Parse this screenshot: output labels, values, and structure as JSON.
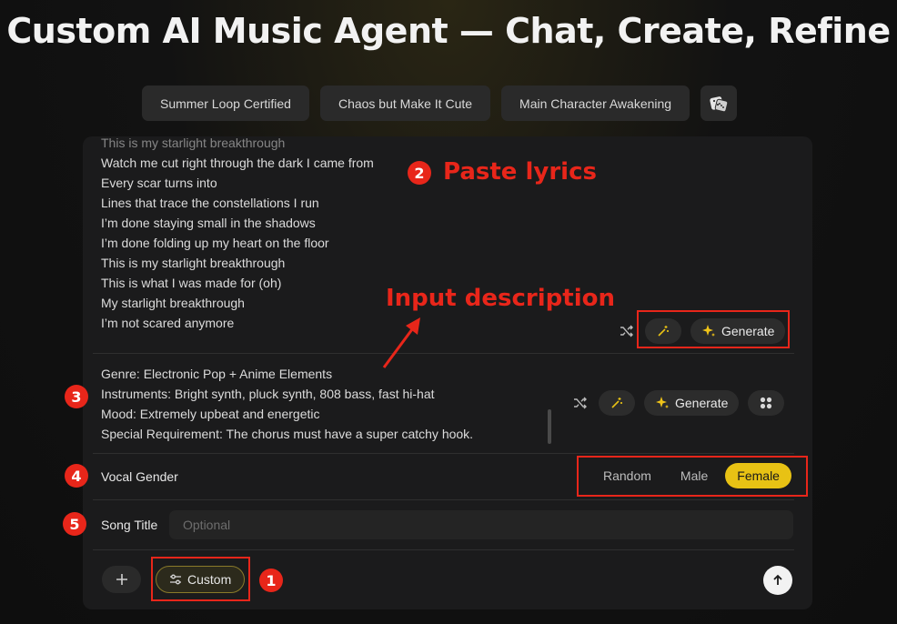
{
  "page": {
    "title": "Custom AI Music Agent — Chat, Create, Refine"
  },
  "presets": [
    {
      "label": "Summer Loop Certified"
    },
    {
      "label": "Chaos but Make It Cute"
    },
    {
      "label": "Main Character Awakening"
    }
  ],
  "lyrics": {
    "lines": [
      "This is my starlight breakthrough",
      "Watch me cut right through the dark I came from",
      "Every scar turns into",
      "Lines that trace the constellations I run",
      "I’m done staying small in the shadows",
      "I’m done folding up my heart on the floor",
      "This is my starlight breakthrough",
      "This is what I was made for (oh)",
      "My starlight breakthrough",
      "I’m not scared anymore"
    ],
    "generate_label": "Generate"
  },
  "description": {
    "lines": [
      "Genre: Electronic Pop + Anime Elements",
      "Instruments: Bright synth, pluck synth, 808 bass, fast hi-hat",
      "Mood: Extremely upbeat and energetic",
      "Special Requirement: The chorus must have a super catchy hook."
    ],
    "generate_label": "Generate"
  },
  "vocal_gender": {
    "label": "Vocal Gender",
    "options": [
      "Random",
      "Male",
      "Female"
    ],
    "selected": "Female"
  },
  "song_title": {
    "label": "Song Title",
    "placeholder": "Optional"
  },
  "bottom_bar": {
    "custom_label": "Custom"
  },
  "annotations": {
    "badges": [
      "1",
      "2",
      "3",
      "4",
      "5"
    ],
    "paste_lyrics": "Paste lyrics",
    "input_description": "Input description"
  },
  "colors": {
    "accent": "#e8c214",
    "annotation": "#e8261a",
    "panel": "#1b1b1c"
  }
}
